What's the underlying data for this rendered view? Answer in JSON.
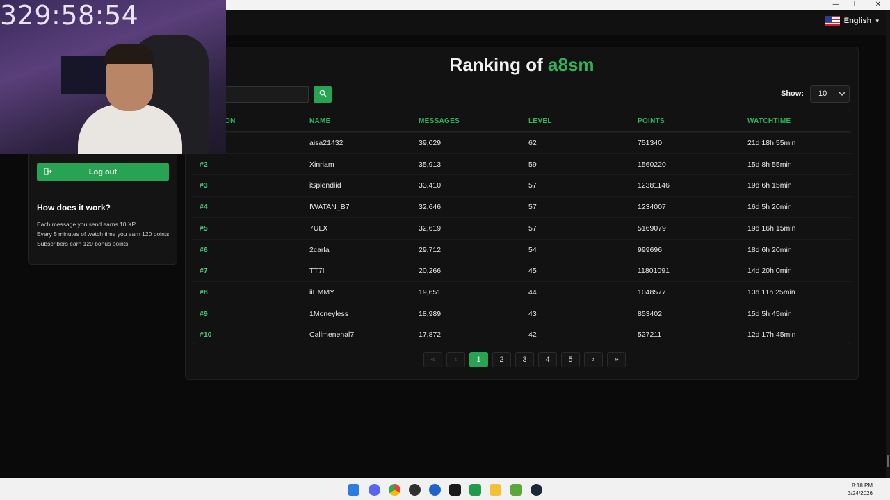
{
  "window": {
    "min": "—",
    "max": "❐",
    "close": "✕"
  },
  "header": {
    "language": "English",
    "language_chevron": "▾"
  },
  "stream": {
    "timer": "329:58:54"
  },
  "sidebar": {
    "logout_label": "Log out",
    "how_title": "How does it work?",
    "how_lines": [
      "Each message you send earns 10 XP",
      "Every 5 minutes of watch time you earn 120 points",
      "Subscribers earn 120 bonus points"
    ]
  },
  "ranking": {
    "title_prefix": "Ranking of",
    "channel": "a8sm",
    "search_placeholder": "",
    "show_label": "Show:",
    "show_value": "10",
    "columns": [
      "ON",
      "NAME",
      "MESSAGES",
      "LEVEL",
      "POINTS",
      "WATCHTIME"
    ],
    "rows": [
      {
        "pos": "",
        "name": "aisa21432",
        "messages": "39,029",
        "level": "62",
        "points": "751340",
        "watchtime": "21d 18h 55min"
      },
      {
        "pos": "#2",
        "name": "Xinriam",
        "messages": "35,913",
        "level": "59",
        "points": "1560220",
        "watchtime": "15d 8h 55min"
      },
      {
        "pos": "#3",
        "name": "iSplendiid",
        "messages": "33,410",
        "level": "57",
        "points": "12381146",
        "watchtime": "19d 6h 15min"
      },
      {
        "pos": "#4",
        "name": "IWATAN_B7",
        "messages": "32,646",
        "level": "57",
        "points": "1234007",
        "watchtime": "16d 5h 20min"
      },
      {
        "pos": "#5",
        "name": "7ULX",
        "messages": "32,619",
        "level": "57",
        "points": "5169079",
        "watchtime": "19d 16h 15min"
      },
      {
        "pos": "#6",
        "name": "2carla",
        "messages": "29,712",
        "level": "54",
        "points": "999696",
        "watchtime": "18d 6h 20min"
      },
      {
        "pos": "#7",
        "name": "TT7I",
        "messages": "20,266",
        "level": "45",
        "points": "11801091",
        "watchtime": "14d 20h 0min"
      },
      {
        "pos": "#8",
        "name": "iiEMMY",
        "messages": "19,651",
        "level": "44",
        "points": "1048577",
        "watchtime": "13d 11h 25min"
      },
      {
        "pos": "#9",
        "name": "1Moneyless",
        "messages": "18,989",
        "level": "43",
        "points": "853402",
        "watchtime": "15d 5h 45min"
      },
      {
        "pos": "#10",
        "name": "Callmenehal7",
        "messages": "17,872",
        "level": "42",
        "points": "527211",
        "watchtime": "12d 17h 45min"
      }
    ],
    "pager": [
      "«",
      "‹",
      "1",
      "2",
      "3",
      "4",
      "5",
      "›",
      "»"
    ]
  },
  "taskbar": {
    "time": "8:18 PM",
    "date": "3/24/2026"
  },
  "colors": {
    "accent": "#27a353",
    "accent_text": "#2fb35d"
  }
}
